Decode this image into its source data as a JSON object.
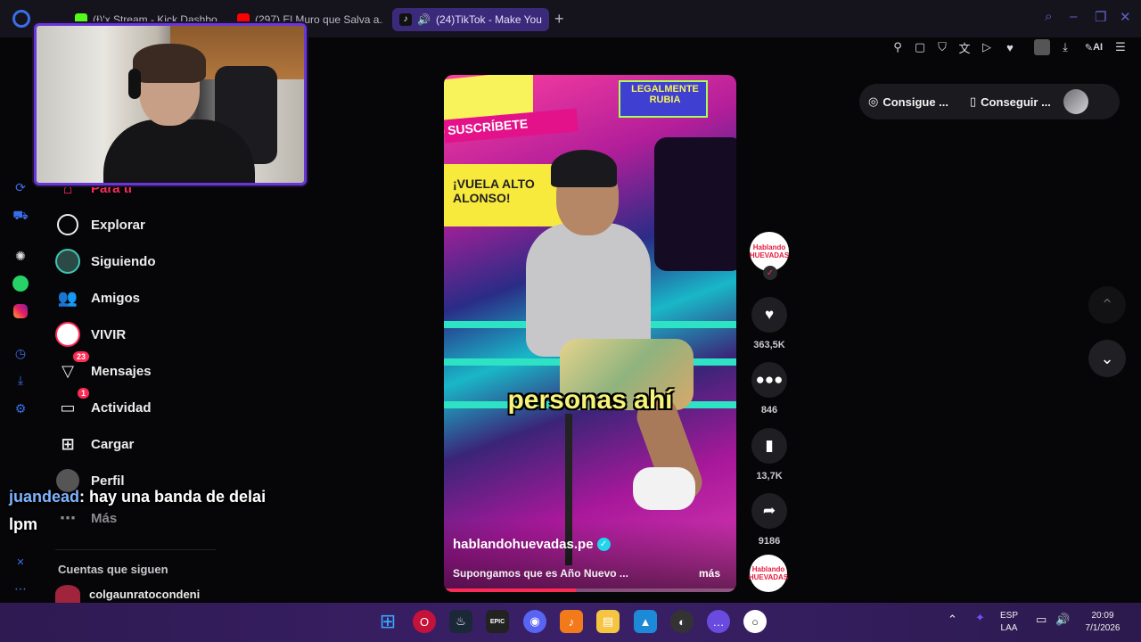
{
  "browser": {
    "tabs": [
      {
        "label": "(Ɨ)'x Stream - Kick Dashbo...",
        "favicon_color": "#53fc18"
      },
      {
        "label": "(297) El Muro que Salva a...",
        "favicon_color": "#ff0000"
      },
      {
        "label": "(24)TikTok - Make You",
        "favicon_color": "#111111",
        "active": true
      }
    ],
    "new_tab": "+",
    "ai_label": "AI"
  },
  "tiktok_nav": {
    "items": [
      {
        "label": "Para ti",
        "icon": "home-icon",
        "active": true
      },
      {
        "label": "Explorar",
        "icon": "compass-icon"
      },
      {
        "label": "Siguiendo",
        "icon": "following-avatar-icon"
      },
      {
        "label": "Amigos",
        "icon": "friends-icon"
      },
      {
        "label": "VIVIR",
        "icon": "live-icon"
      },
      {
        "label": "Mensajes",
        "icon": "messages-icon",
        "badge": "23"
      },
      {
        "label": "Actividad",
        "icon": "activity-icon",
        "badge": "1"
      },
      {
        "label": "Cargar",
        "icon": "upload-icon"
      },
      {
        "label": "Perfil",
        "icon": "profile-icon"
      },
      {
        "label": "Más",
        "icon": "more-icon"
      }
    ],
    "following_header": "Cuentas que siguen",
    "following_first": "colgaunratocondeni"
  },
  "chat_overlay": {
    "user": "juandead",
    "message": ": hay una banda de delai",
    "continuation": "lpm"
  },
  "video": {
    "caption": "personas ahí",
    "author": "hablandohuevadas.pe",
    "description": "Supongamos que es Año Nuevo ...",
    "more": "más",
    "background_texts": [
      "SUSCRÍBETE",
      "LEGALMENTE RUBIA",
      "¡VUELA ALTO ALONSO!"
    ],
    "progress": 0.45
  },
  "actions": {
    "creator_avatar_text": "Hablando HUEVADAS",
    "likes": "363,5K",
    "comments": "846",
    "saves": "13,7K",
    "shares": "9186"
  },
  "top_right": {
    "coins_label": "Consigue ...",
    "app_label": "Conseguir ..."
  },
  "taskbar": {
    "lang_line1": "ESP",
    "lang_line2": "LAA",
    "time": "20:09",
    "date": "7/1/2026"
  },
  "colors": {
    "accent": "#fe2c55",
    "opera_tab": "#3b2a7a",
    "taskbar": "#3a2068",
    "webcam_border": "#6b36d8"
  }
}
